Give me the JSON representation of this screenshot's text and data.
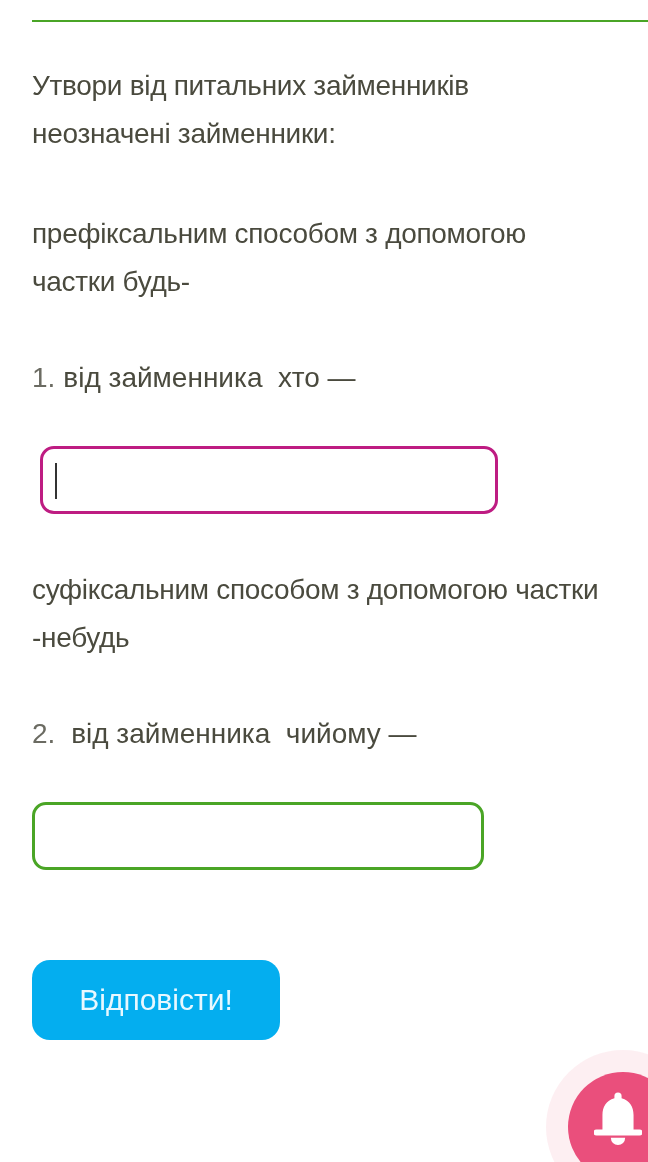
{
  "intro": "Утвори від питальних займенників неозначені займенники:",
  "sections": [
    {
      "instruction": "префіксальним способом з допомогою частки будь-",
      "number": "1.",
      "prompt": "від займенника  хто —",
      "answer": {
        "focused": true
      }
    },
    {
      "instruction": "суфіксальним способом з допомогою частки -небудь",
      "number": "2.",
      "prompt": " від займенника  чийому —",
      "answer": {
        "focused": false
      }
    }
  ],
  "submit": "Відповісти!"
}
